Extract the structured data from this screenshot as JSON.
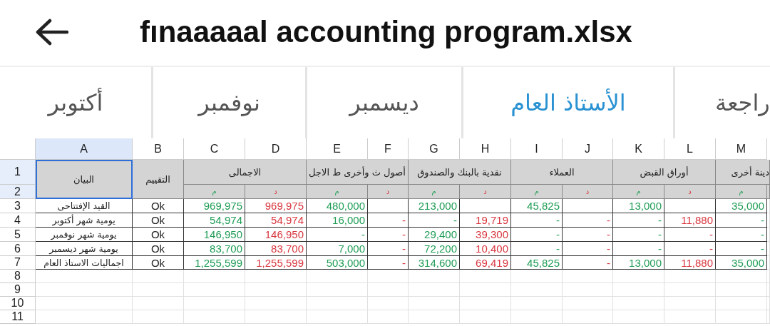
{
  "header": {
    "title": "fınaaaaal accounting program.xlsx"
  },
  "tabs": [
    {
      "label": "راجعة",
      "selected": false
    },
    {
      "label": "الأستاذ العام",
      "selected": true
    },
    {
      "label": "ديسمبر",
      "selected": false
    },
    {
      "label": "نوفمبر",
      "selected": false
    },
    {
      "label": "أكتوبر",
      "selected": false
    }
  ],
  "sheet": {
    "columns": [
      {
        "label": "M",
        "selected": false
      },
      {
        "label": "L",
        "selected": false
      },
      {
        "label": "K",
        "selected": false
      },
      {
        "label": "J",
        "selected": false
      },
      {
        "label": "I",
        "selected": false
      },
      {
        "label": "H",
        "selected": false
      },
      {
        "label": "G",
        "selected": false
      },
      {
        "label": "F",
        "selected": false
      },
      {
        "label": "E",
        "selected": false
      },
      {
        "label": "D",
        "selected": false
      },
      {
        "label": "C",
        "selected": false
      },
      {
        "label": "B",
        "selected": false
      },
      {
        "label": "A",
        "selected": true
      }
    ],
    "row_headers": [
      {
        "label": "1",
        "selected": true
      },
      {
        "label": "2",
        "selected": true
      },
      {
        "label": "3",
        "selected": false
      },
      {
        "label": "4",
        "selected": false
      },
      {
        "label": "5",
        "selected": false
      },
      {
        "label": "6",
        "selected": false
      },
      {
        "label": "7",
        "selected": false
      },
      {
        "label": "8",
        "selected": false
      },
      {
        "label": "9",
        "selected": false
      },
      {
        "label": "10",
        "selected": false
      },
      {
        "label": "11",
        "selected": false
      }
    ],
    "fixed_headers": [
      {
        "label": "التقييم",
        "selected": false
      },
      {
        "label": "البيان",
        "selected": true
      }
    ],
    "groups": [
      {
        "label": "دينة أخرى",
        "sides": [
          {
            "label": "م",
            "kind": "debit"
          }
        ]
      },
      {
        "label": "أوراق القبض",
        "sides": [
          {
            "label": "د",
            "kind": "credit"
          },
          {
            "label": "م",
            "kind": "debit"
          }
        ]
      },
      {
        "label": "العملاء",
        "sides": [
          {
            "label": "د",
            "kind": "credit"
          },
          {
            "label": "م",
            "kind": "debit"
          }
        ]
      },
      {
        "label": "نقدية بالبنك والصندوق",
        "sides": [
          {
            "label": "د",
            "kind": "credit"
          },
          {
            "label": "م",
            "kind": "debit"
          }
        ]
      },
      {
        "label": "أصول ث وأخرى ط الاجل",
        "sides": [
          {
            "label": "د",
            "kind": "credit"
          },
          {
            "label": "م",
            "kind": "debit"
          }
        ]
      },
      {
        "label": "الاجمالى",
        "sides": [
          {
            "label": "د",
            "kind": "credit"
          },
          {
            "label": "م",
            "kind": "debit"
          }
        ]
      }
    ],
    "rows": [
      {
        "rating": "Ok",
        "statement": "القيد الإفتتاحى",
        "values": {
          "col_m": "35,000",
          "col_k": "13,000",
          "col_i": "45,825",
          "col_g": "213,000",
          "col_e": "480,000",
          "col_d": "969,975",
          "col_c": "969,975"
        }
      },
      {
        "rating": "Ok",
        "statement": "يومية شهر أكتوبر",
        "values": {
          "col_m": "-",
          "col_l": "11,880",
          "col_k": "-",
          "col_j": "-",
          "col_i": "-",
          "col_h": "19,719",
          "col_g": "-",
          "col_f": "-",
          "col_e": "16,000",
          "col_d": "54,974",
          "col_c": "54,974"
        }
      },
      {
        "rating": "Ok",
        "statement": "يومية شهر نوفمبر",
        "values": {
          "col_m": "-",
          "col_l": "-",
          "col_k": "-",
          "col_j": "-",
          "col_i": "-",
          "col_h": "39,300",
          "col_g": "29,400",
          "col_f": "-",
          "col_e": "-",
          "col_d": "146,950",
          "col_c": "146,950"
        }
      },
      {
        "rating": "Ok",
        "statement": "يومية شهر ديسمبر",
        "values": {
          "col_m": "-",
          "col_l": "-",
          "col_k": "-",
          "col_j": "-",
          "col_i": "-",
          "col_h": "10,400",
          "col_g": "72,200",
          "col_f": "-",
          "col_e": "7,000",
          "col_d": "83,700",
          "col_c": "83,700"
        }
      },
      {
        "rating": "Ok",
        "statement": "اجماليات الاستاذ العام",
        "values": {
          "col_m": "35,000",
          "col_l": "11,880",
          "col_k": "13,000",
          "col_j": "-",
          "col_i": "45,825",
          "col_h": "69,419",
          "col_g": "314,600",
          "col_f": "-",
          "col_e": "503,000",
          "col_d": "1,255,599",
          "col_c": "1,255,599"
        }
      }
    ]
  }
}
